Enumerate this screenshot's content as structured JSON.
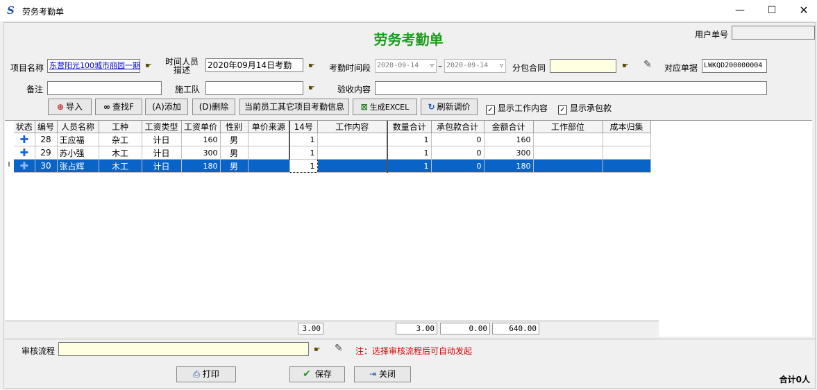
{
  "window": {
    "title": "劳务考勤单"
  },
  "form": {
    "heading": "劳务考勤单",
    "user_no_label": "用户单号",
    "user_no_value": "",
    "project_label": "项目名称",
    "project_value": "东营阳光100城市丽园一期",
    "time_person_label_1": "时间人员",
    "time_person_label_2": "描述",
    "time_person_value": "2020年09月14日考勤",
    "period_label": "考勤时间段",
    "date_from": "2020-09-14",
    "date_to": "2020-09-14",
    "date_sep": "–",
    "subcontract_label": "分包合同",
    "subcontract_value": "",
    "ref_label": "对应单据",
    "ref_value": "LWKQD200000004",
    "remark_label": "备注",
    "remark_value": "",
    "team_label": "施工队",
    "team_value": "",
    "accept_label": "验收内容",
    "accept_value": ""
  },
  "toolbar": {
    "import": "导入",
    "find": "查找F",
    "add": "(A)添加",
    "delete": "(D)删除",
    "other_info": "当前员工其它项目考勤信息",
    "excel": "生成EXCEL",
    "refresh": "刷新调价",
    "show_work": "显示工作内容",
    "show_contract": "显示承包款"
  },
  "grid": {
    "headers": [
      "状态",
      "编号",
      "人员名称",
      "工种",
      "工资类型",
      "工资单价",
      "性别",
      "单价来源",
      "14号",
      "工作内容",
      "数量合计",
      "承包款合计",
      "金额合计",
      "工作部位",
      "成本归集"
    ],
    "rows": [
      {
        "id": "28",
        "name": "王应福",
        "trade": "杂工",
        "wage_type": "计日",
        "price": "160",
        "sex": "男",
        "source": "",
        "d14": "1",
        "work": "",
        "qty": "1",
        "contract": "0",
        "amount": "160",
        "part": "",
        "cost": ""
      },
      {
        "id": "29",
        "name": "苏小强",
        "trade": "木工",
        "wage_type": "计日",
        "price": "300",
        "sex": "男",
        "source": "",
        "d14": "1",
        "work": "",
        "qty": "1",
        "contract": "0",
        "amount": "300",
        "part": "",
        "cost": ""
      },
      {
        "id": "30",
        "name": "张占辉",
        "trade": "木工",
        "wage_type": "计日",
        "price": "180",
        "sex": "男",
        "source": "",
        "d14": "1",
        "work": "",
        "qty": "1",
        "contract": "0",
        "amount": "180",
        "part": "",
        "cost": ""
      }
    ],
    "cursor_mark": "I",
    "totals": {
      "d14": "3.00",
      "qty": "3.00",
      "contract": "0.00",
      "amount": "640.00"
    }
  },
  "approval": {
    "label": "审核流程",
    "value": "",
    "note": "注：选择审核流程后可自动发起"
  },
  "bottom": {
    "print": "打印",
    "save": "保存",
    "close": "关闭",
    "total": "合计0人"
  },
  "colors": {
    "heading": "#1d9b1d",
    "selection": "#0a64c8",
    "note": "#d00000"
  }
}
